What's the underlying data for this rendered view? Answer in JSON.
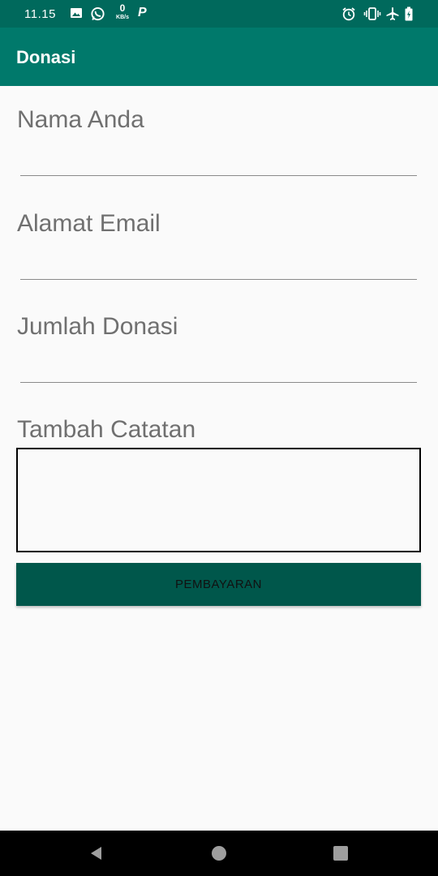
{
  "status_bar": {
    "time": "11.15",
    "net_speed_value": "0",
    "net_speed_unit": "KB/s",
    "app_letter": "P",
    "icons": [
      "image-icon",
      "whatsapp-icon",
      "alarm-icon",
      "vibrate-icon",
      "airplane-icon",
      "battery-icon"
    ]
  },
  "app_bar": {
    "title": "Donasi"
  },
  "form": {
    "name_label": "Nama Anda",
    "email_label": "Alamat Email",
    "amount_label": "Jumlah Donasi",
    "notes_label": "Tambah Catatan",
    "pay_button_label": "PEMBAYARAN"
  },
  "nav_bar": {
    "icons": [
      "back-icon",
      "home-icon",
      "recents-icon"
    ]
  },
  "colors": {
    "status_bar": "#00695c",
    "app_bar": "#00796b",
    "button": "#00574b",
    "background": "#fafafa"
  }
}
